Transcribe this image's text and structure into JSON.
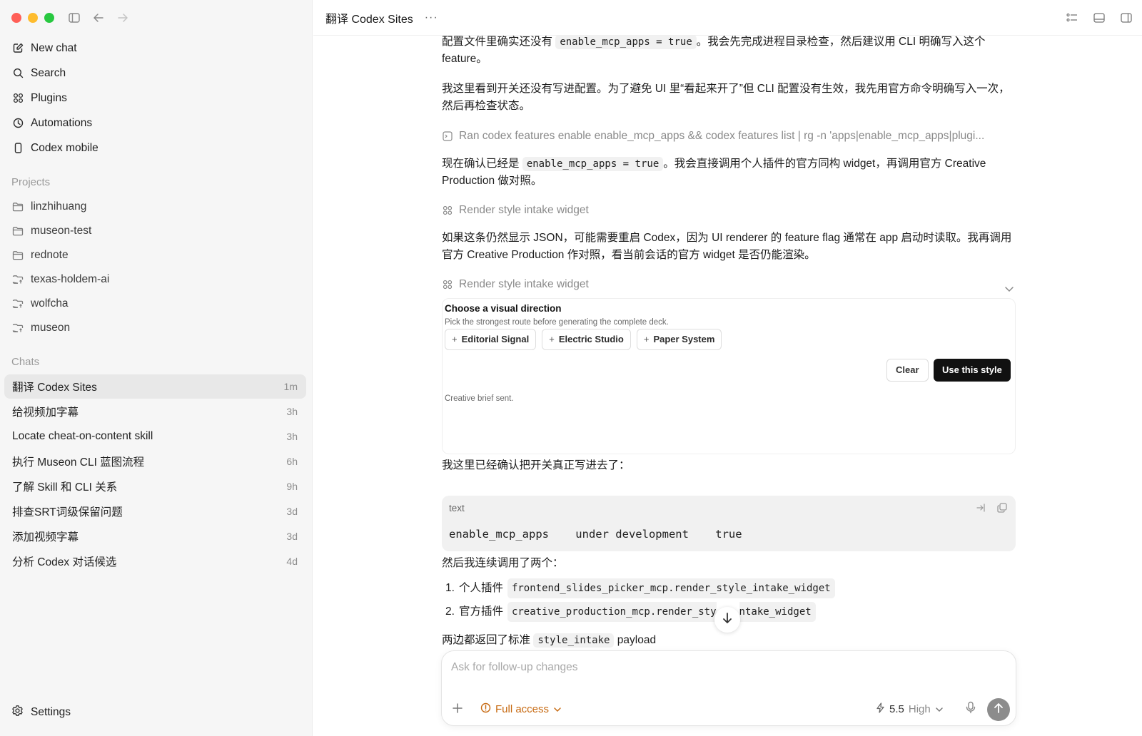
{
  "sidebar": {
    "nav": [
      {
        "label": "New chat",
        "icon": "compose-icon"
      },
      {
        "label": "Search",
        "icon": "search-icon"
      },
      {
        "label": "Plugins",
        "icon": "grid-icon"
      },
      {
        "label": "Automations",
        "icon": "clock-icon"
      },
      {
        "label": "Codex mobile",
        "icon": "phone-icon"
      }
    ],
    "projects_label": "Projects",
    "projects": [
      "linzhihuang",
      "museon-test",
      "rednote",
      "texas-holdem-ai",
      "wolfcha",
      "museon"
    ],
    "chats_label": "Chats",
    "chats": [
      {
        "title": "翻译 Codex Sites",
        "time": "1m"
      },
      {
        "title": "给视频加字幕",
        "time": "3h"
      },
      {
        "title": "Locate cheat-on-content skill",
        "time": "3h"
      },
      {
        "title": "执行 Museon CLI 蓝图流程",
        "time": "6h"
      },
      {
        "title": "了解 Skill 和 CLI 关系",
        "time": "9h"
      },
      {
        "title": "排查SRT词级保留问题",
        "time": "3d"
      },
      {
        "title": "添加视频字幕",
        "time": "3d"
      },
      {
        "title": "分析 Codex 对话候选",
        "time": "4d"
      }
    ],
    "settings_label": "Settings"
  },
  "header": {
    "title": "翻译 Codex Sites",
    "more": "···"
  },
  "messages": {
    "p1_a": "配置文件里确实还没有 ",
    "p1_code": "enable_mcp_apps = true",
    "p1_b": "。我会先完成进程目录检查，然后建议用 CLI 明确写入这个 feature。",
    "p2": "我这里看到开关还没有写进配置。为了避免 UI 里“看起来开了”但 CLI 配置没有生效，我先用官方命令明确写入一次，然后再检查状态。",
    "tool1": "Ran codex features enable enable_mcp_apps && codex features list | rg -n 'apps|enable_mcp_apps|plugi...",
    "p3_a": "现在确认已经是 ",
    "p3_code": "enable_mcp_apps = true",
    "p3_b": "。我会直接调用个人插件的官方同构 widget，再调用官方 Creative Production 做对照。",
    "tool2": "Render style intake widget",
    "p4": "如果这条仍然显示 JSON，可能需要重启 Codex，因为 UI renderer 的 feature flag 通常在 app 启动时读取。我再调用官方 Creative Production 作对照，看当前会话的官方 widget 是否仍能渲染。",
    "tool3": "Render style intake widget",
    "p5": "我这里已经确认把开关真正写进去了：",
    "p6": "然后我连续调用了两个：",
    "list": [
      {
        "num": "1.",
        "label": "个人插件",
        "code": "frontend_slides_picker_mcp.render_style_intake_widget"
      },
      {
        "num": "2.",
        "label": "官方插件",
        "code": "creative_production_mcp.render_sty"
      },
      {
        "num": "",
        "label": "",
        "code": "ntake_widget"
      }
    ],
    "p7_a": "两边都返回了标准 ",
    "p7_code": "style_intake",
    "p7_b": " payload"
  },
  "widget": {
    "title": "Choose a visual direction",
    "subtitle": "Pick the strongest route before generating the complete deck.",
    "options": [
      "Editorial Signal",
      "Electric Studio",
      "Paper System"
    ],
    "clear_label": "Clear",
    "use_label": "Use this style",
    "status": "Creative brief sent."
  },
  "codeblock": {
    "lang": "text",
    "content": "enable_mcp_apps    under development    true"
  },
  "composer": {
    "placeholder": "Ask for follow-up changes",
    "access_label": "Full access",
    "model": "5.5",
    "effort": "High"
  },
  "colors": {
    "access": "#c76a12",
    "send_button": "#8c8c8c",
    "use_button": "#111111"
  }
}
